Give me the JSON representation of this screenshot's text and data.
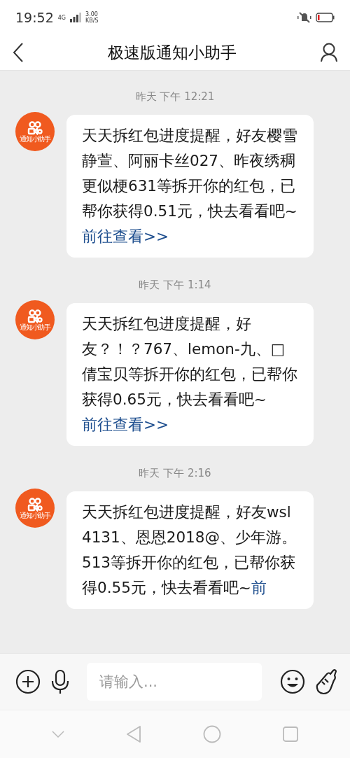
{
  "status_bar": {
    "time": "19:52",
    "network": "4G",
    "speed_value": "3.00",
    "speed_unit": "KB/S"
  },
  "header": {
    "title": "极速版通知小助手"
  },
  "messages": [
    {
      "timestamp": "昨天 下午 12:21",
      "avatar_label": "通知小助手",
      "text": "天天拆红包进度提醒，好友樱雪静萱、阿丽卡丝027、昨夜绣稠更似梗631等拆开你的红包，已帮你获得0.51元，快去看看吧~",
      "link": "前往查看>>"
    },
    {
      "timestamp": "昨天 下午 1:14",
      "avatar_label": "通知小助手",
      "text": "天天拆红包进度提醒，好友？！？767、lemon-九、□倩宝贝等拆开你的红包，已帮你获得0.65元，快去看看吧~",
      "link": "前往查看>>"
    },
    {
      "timestamp": "昨天 下午 2:16",
      "avatar_label": "通知小助手",
      "text": "天天拆红包进度提醒，好友wsl4131、恩恩2018@、少年游。513等拆开你的红包，已帮你获得0.55元，快去看看吧~",
      "link": "前"
    }
  ],
  "input": {
    "placeholder": "请输入..."
  }
}
